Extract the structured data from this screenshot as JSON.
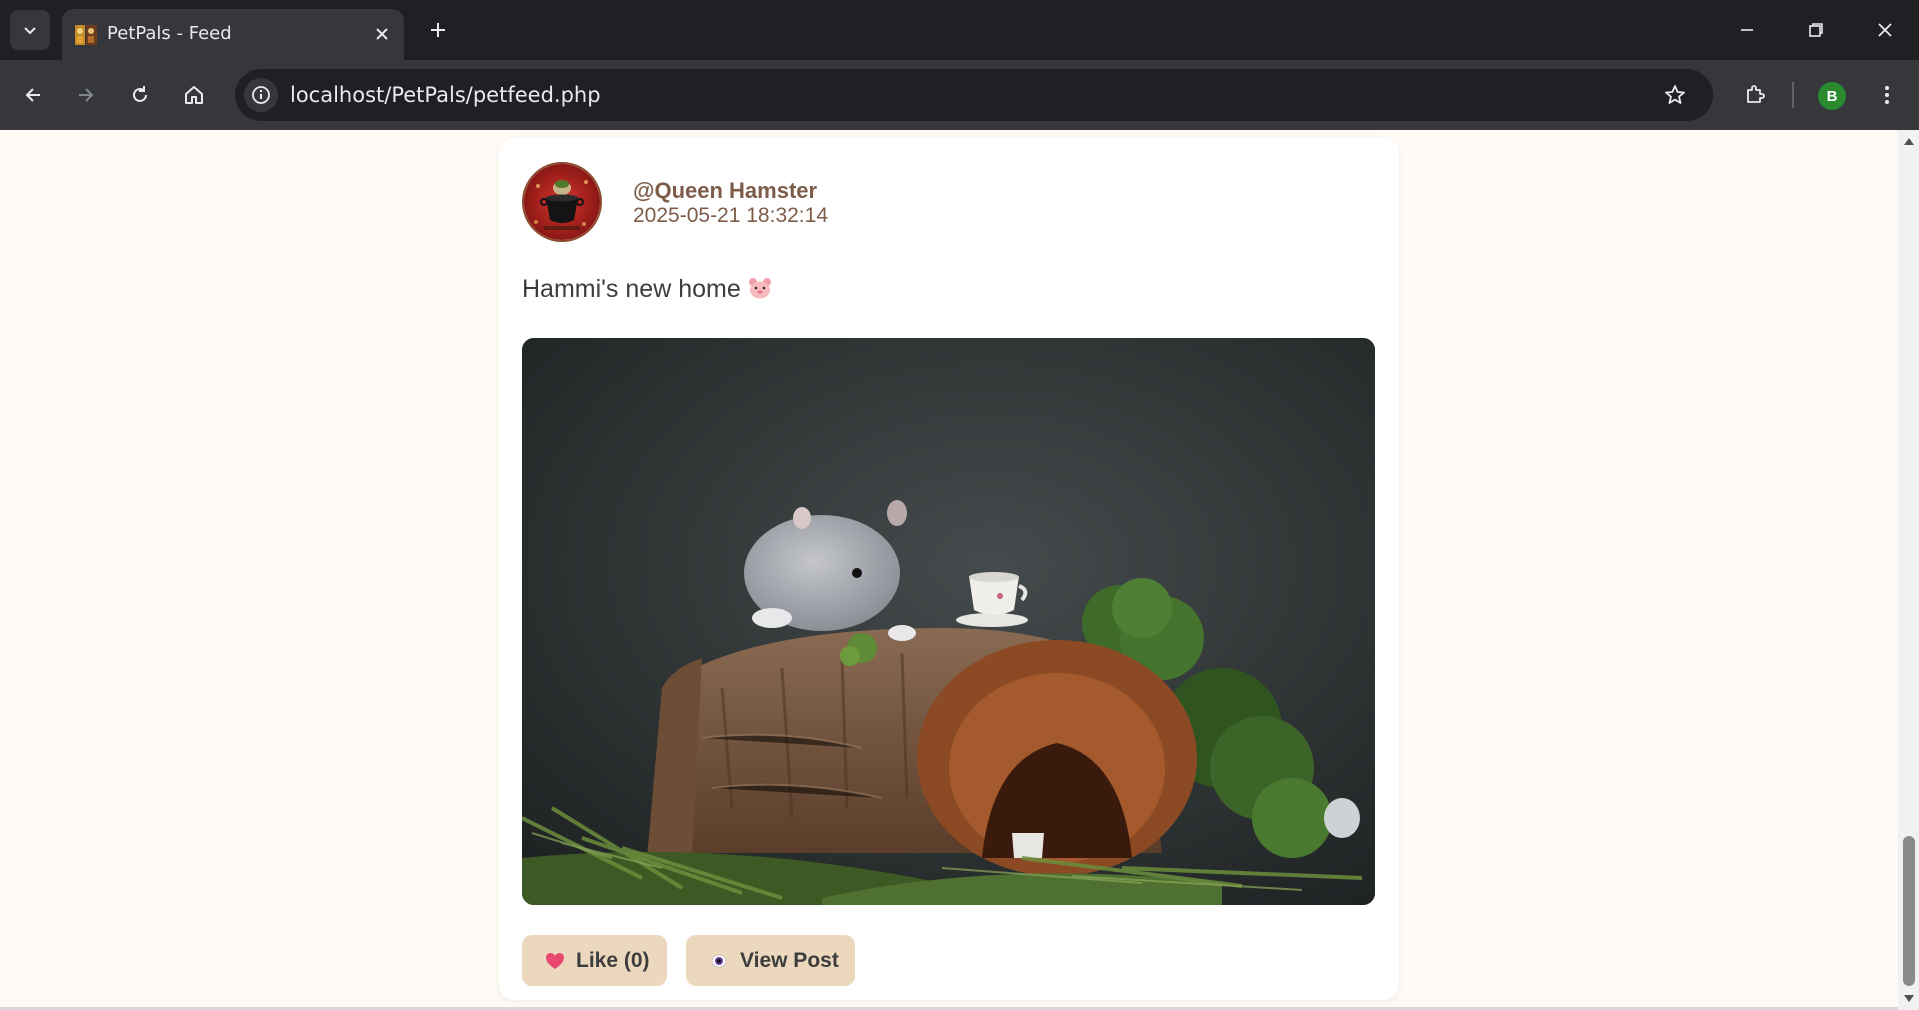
{
  "browser": {
    "tab_title": "PetPals - Feed",
    "url": "localhost/PetPals/petfeed.php",
    "profile_initial": "B"
  },
  "post": {
    "username": "@Queen Hamster",
    "timestamp": "2025-05-21 18:32:14",
    "caption": "Hammi's new home",
    "caption_emoji": "hamster-face",
    "like_label": "Like (0)",
    "like_icon": "heart-icon",
    "view_label": "View Post",
    "view_icon": "eye-icon"
  },
  "colors": {
    "page_bg": "#fffaf5",
    "card_bg": "#ffffff",
    "button_bg": "#ebd8bd",
    "username_color": "#7d5d4a",
    "heart": "#e84a6f"
  }
}
